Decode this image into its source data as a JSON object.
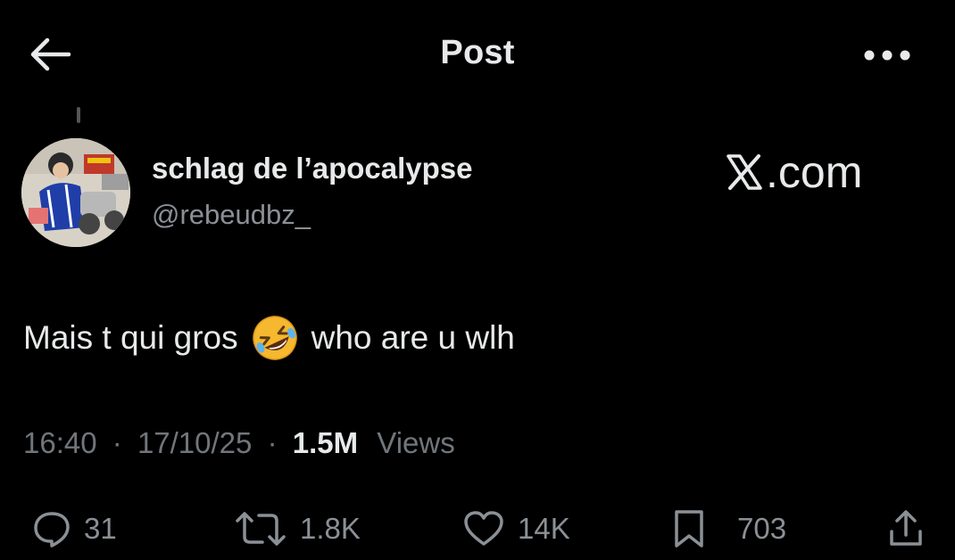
{
  "header": {
    "title": "Post",
    "back_icon": "arrow-left-icon",
    "more_icon": "more-horizontal-icon"
  },
  "author": {
    "display_name": "schlag de l’apocalypse",
    "handle": "@rebeudbz_"
  },
  "watermark": {
    "logo": "x-logo",
    "text": ".com"
  },
  "post": {
    "text_before": "Mais t qui gros",
    "emoji": "rolling-on-floor-laughing",
    "text_after": "who are u wlh"
  },
  "meta": {
    "time": "16:40",
    "separator": "·",
    "date": "17/10/25",
    "views_count": "1.5M",
    "views_label": "Views"
  },
  "actions": {
    "replies": "31",
    "reposts": "1.8K",
    "likes": "14K",
    "bookmarks": "703"
  },
  "colors": {
    "background": "#000000",
    "text_primary": "#e7e9ea",
    "text_secondary": "#71767b"
  }
}
